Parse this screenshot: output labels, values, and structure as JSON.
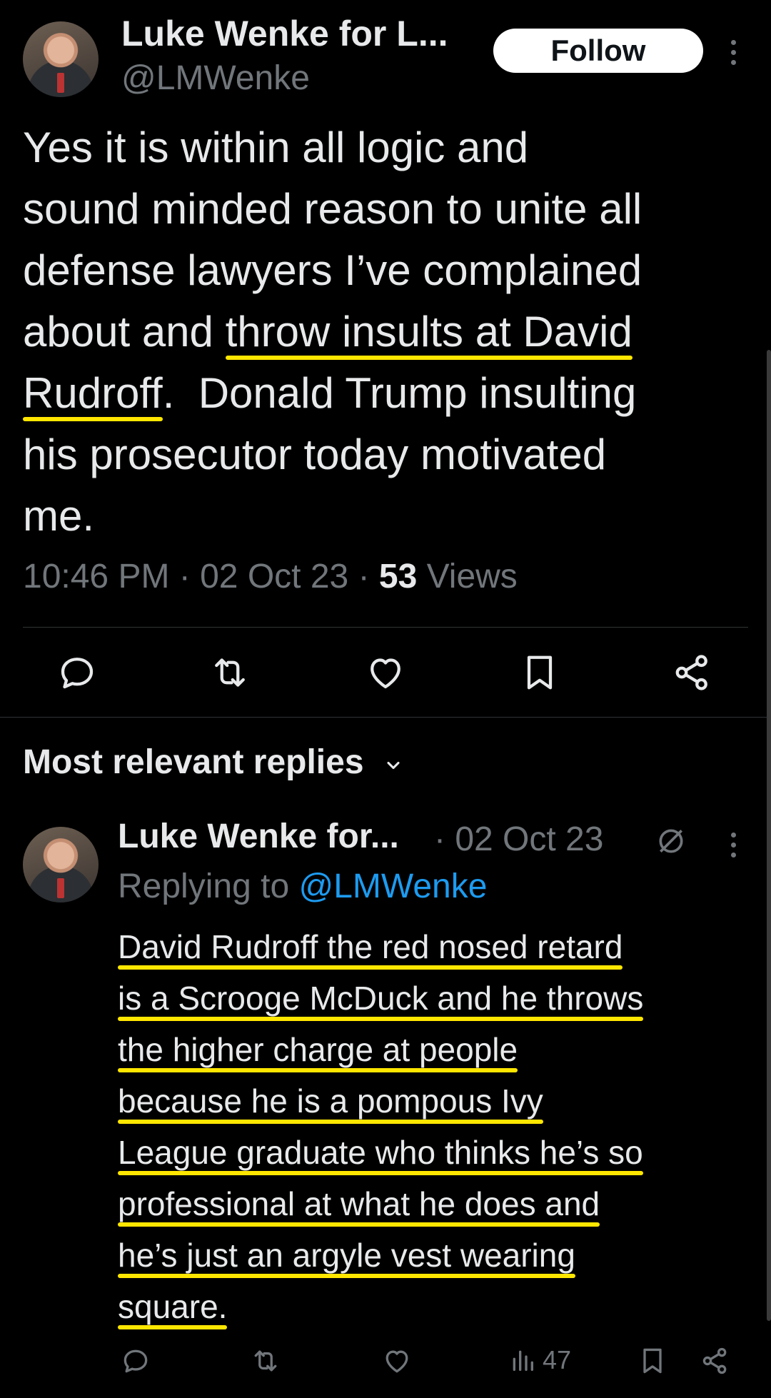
{
  "tweet": {
    "author_name": "Luke Wenke for L...",
    "author_handle": "@LMWenke",
    "follow_label": "Follow",
    "lines": [
      {
        "plain": "Yes it is within all logic and",
        "hl": ""
      },
      {
        "plain": "sound minded reason to unite all",
        "hl": ""
      },
      {
        "plain": "defense lawyers I’ve complained",
        "hl": ""
      },
      {
        "plain": "about and ",
        "hl": "throw insults at David"
      },
      {
        "hl": "Rudroff",
        "after": ".  Donald Trump insulting"
      },
      {
        "plain": "his prosecutor today motivated",
        "hl": ""
      },
      {
        "plain": "me.",
        "hl": ""
      }
    ],
    "time": "10:46 PM",
    "date": "02 Oct 23",
    "views_count": "53",
    "views_label": "Views",
    "separator": " · "
  },
  "replies_section": {
    "title": "Most relevant replies"
  },
  "reply": {
    "author_name": "Luke Wenke for...",
    "date": "· 02 Oct 23",
    "replying_to_label": "Replying to",
    "replying_to_handle": "@LMWenke",
    "lines": [
      "David Rudroff the red nosed retard",
      "is a Scrooge McDuck and he throws",
      "the higher charge at people",
      "because he is a pompous Ivy",
      "League graduate who thinks he’s so",
      "professional at what he does and",
      "he’s just an argyle vest wearing",
      "square."
    ],
    "views": "47"
  },
  "colors": {
    "background": "#000000",
    "text": "#e7e9ea",
    "muted": "#71767b",
    "link": "#1d9bf0",
    "highlight": "#ffe600"
  },
  "icons": {
    "actions": [
      "reply-icon",
      "retweet-icon",
      "like-icon",
      "bookmark-icon",
      "share-icon"
    ],
    "reply_actions": [
      "reply-icon",
      "retweet-icon",
      "like-icon",
      "views-icon",
      "bookmark-icon",
      "share-icon"
    ]
  }
}
